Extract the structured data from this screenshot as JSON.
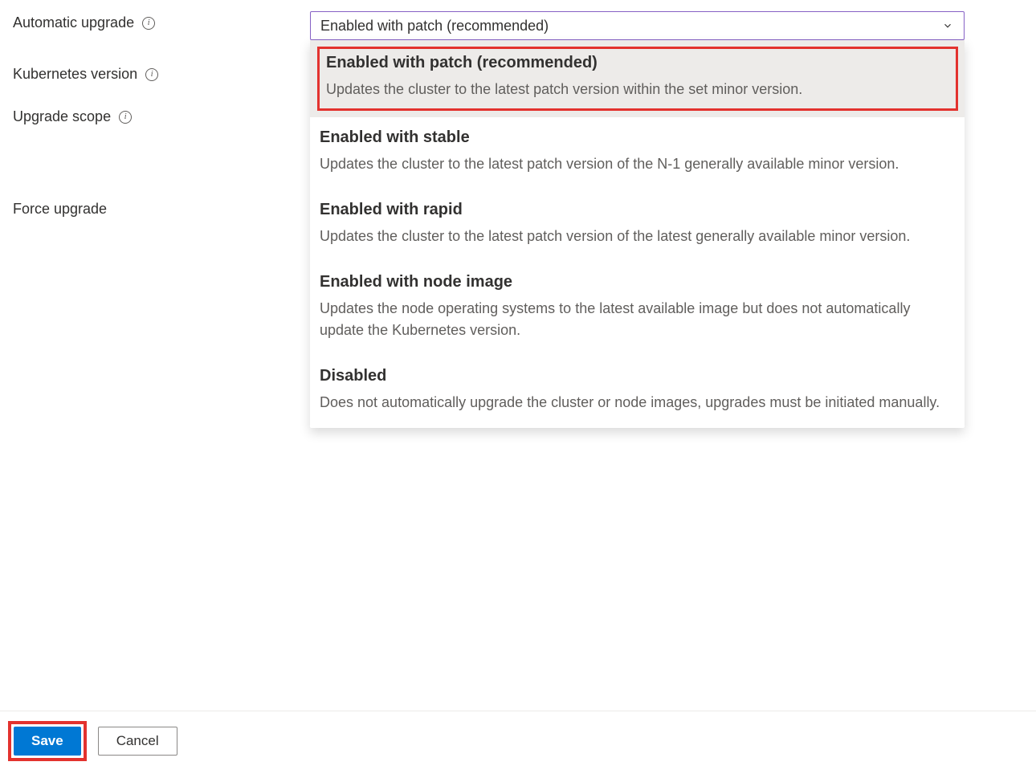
{
  "labels": {
    "automatic_upgrade": "Automatic upgrade",
    "kubernetes_version": "Kubernetes version",
    "upgrade_scope": "Upgrade scope",
    "force_upgrade": "Force upgrade"
  },
  "select": {
    "value": "Enabled with patch (recommended)"
  },
  "options": [
    {
      "title": "Enabled with patch (recommended)",
      "desc": "Updates the cluster to the latest patch version within the set minor version.",
      "selected": true,
      "highlighted": true
    },
    {
      "title": "Enabled with stable",
      "desc": "Updates the cluster to the latest patch version of the N-1 generally available minor version.",
      "selected": false,
      "highlighted": false
    },
    {
      "title": "Enabled with rapid",
      "desc": "Updates the cluster to the latest patch version of the latest generally available minor version.",
      "selected": false,
      "highlighted": false
    },
    {
      "title": "Enabled with node image",
      "desc": "Updates the node operating systems to the latest available image but does not automatically update the Kubernetes version.",
      "selected": false,
      "highlighted": false
    },
    {
      "title": "Disabled",
      "desc": "Does not automatically upgrade the cluster or node images, upgrades must be initiated manually.",
      "selected": false,
      "highlighted": false
    }
  ],
  "footer": {
    "save": "Save",
    "cancel": "Cancel"
  }
}
